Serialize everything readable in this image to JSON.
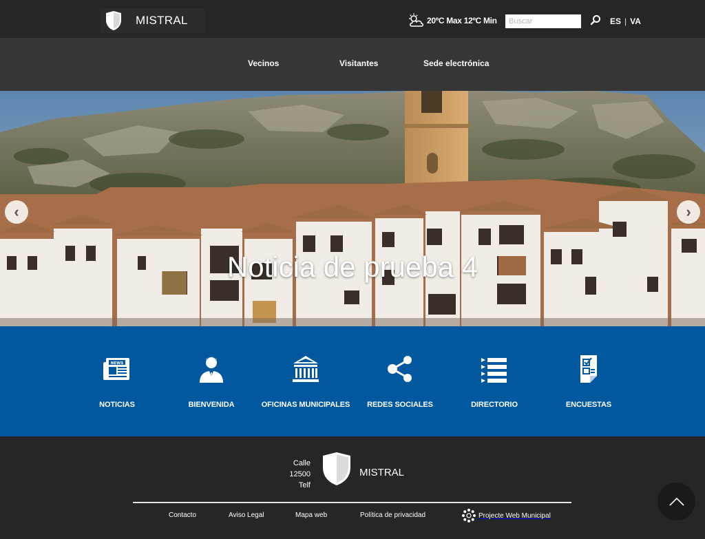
{
  "header": {
    "brand": "MISTRAL",
    "weather": "20ºC Max 12ºC Min",
    "search_placeholder": "Buscar",
    "lang": [
      "ES",
      "VA"
    ]
  },
  "nav": {
    "items": [
      "Vecinos",
      "Visitantes",
      "Sede electrónica"
    ]
  },
  "hero": {
    "title": "Noticia de prueba 4",
    "prev_label": "‹",
    "next_label": "›"
  },
  "quicklinks": [
    {
      "label": "NOTICIAS",
      "icon": "newspaper-icon"
    },
    {
      "label": "BIENVENIDA",
      "icon": "person-icon"
    },
    {
      "label": "OFICINAS MUNICIPALES",
      "icon": "building-icon"
    },
    {
      "label": "REDES SOCIALES",
      "icon": "share-icon"
    },
    {
      "label": "DIRECTORIO",
      "icon": "list-icon"
    },
    {
      "label": "ENCUESTAS",
      "icon": "survey-icon"
    }
  ],
  "footer": {
    "address_lines": [
      "Calle",
      "12500",
      "Telf"
    ],
    "brand": "MISTRAL",
    "links": [
      "Contacto",
      "Aviso Legal",
      "Mapa web",
      "Política de privacidad"
    ],
    "projecte": "Projecte Web Municipal"
  },
  "colors": {
    "topbar": "#262626",
    "navbar": "#363636",
    "quicklinks_bg": "#02589f",
    "footer": "#262626"
  }
}
